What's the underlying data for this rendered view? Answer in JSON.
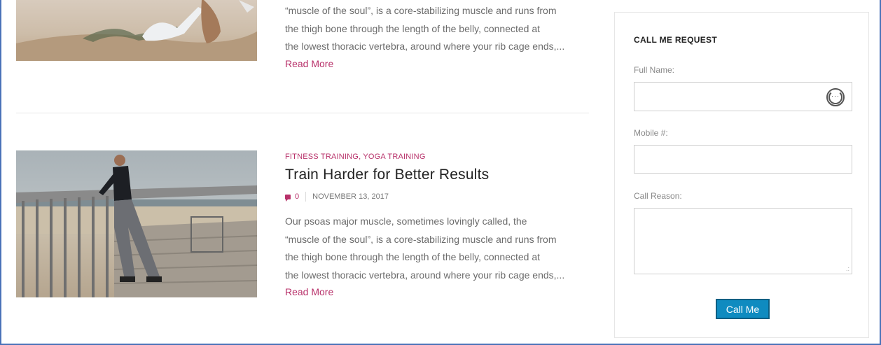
{
  "post_top": {
    "excerpt": [
      "“muscle of the soul”, is a core-stabilizing muscle and runs from",
      "the thigh bone through the length of the belly, connected at",
      "the lowest thoracic vertebra, around where your rib cage ends,..."
    ],
    "read_more": "Read More"
  },
  "post": {
    "categories": "FITNESS TRAINING, YOGA TRAINING",
    "title": "Train Harder for Better Results",
    "comment_count": "0",
    "date": "NOVEMBER 13, 2017",
    "excerpt": [
      "Our psoas major muscle, sometimes lovingly called, the",
      "“muscle of the soul”, is a core-stabilizing muscle and runs from",
      "the thigh bone through the length of the belly, connected at",
      "the lowest thoracic vertebra, around where your rib cage ends,..."
    ],
    "read_more": "Read More"
  },
  "widget": {
    "title": "CALL ME REQUEST",
    "full_name_label": "Full Name:",
    "full_name_value": "",
    "mobile_label": "Mobile #:",
    "mobile_value": "",
    "reason_label": "Call Reason:",
    "reason_value": "",
    "button_label": "Call Me",
    "button_color": "#0f8bc0"
  },
  "colors": {
    "accent": "#b8316a",
    "frame_border": "#4a72b8"
  }
}
